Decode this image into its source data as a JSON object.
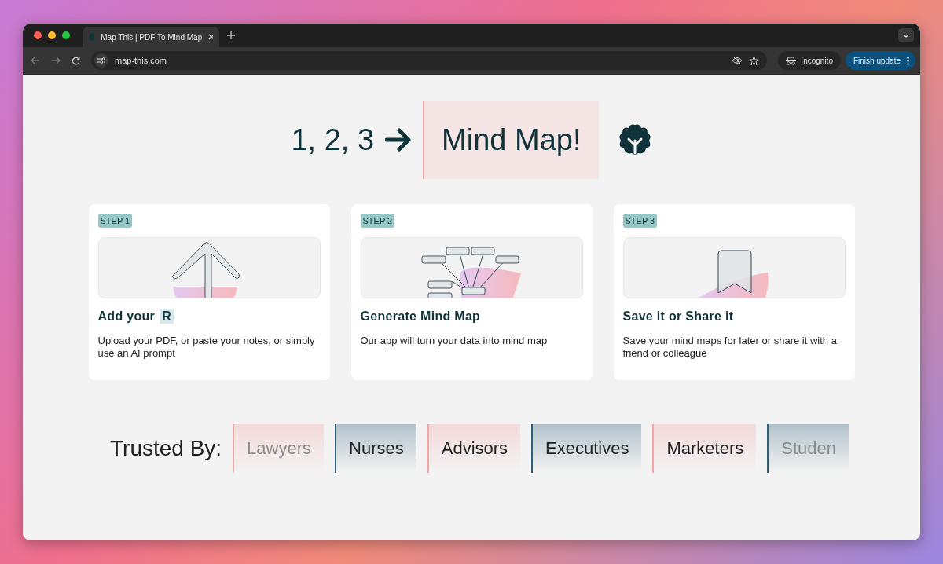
{
  "browser": {
    "tab_title": "Map This | PDF To Mind Map",
    "address": "map-this.com",
    "profile": "Incognito",
    "update_button": "Finish update"
  },
  "hero": {
    "lead": "1, 2, 3",
    "title": "Mind Map!"
  },
  "steps": [
    {
      "badge": "STEP 1",
      "kind": "upload",
      "heading": "Add your",
      "heading_highlight": "R",
      "text": "Upload your PDF, or paste your notes, or simply use an AI prompt"
    },
    {
      "badge": "STEP 2",
      "kind": "mindmap",
      "heading": "Generate Mind Map",
      "text": "Our app will turn your data into mind map"
    },
    {
      "badge": "STEP 3",
      "kind": "bookmark",
      "heading": "Save it or Share it",
      "text": "Save your mind maps for later or share it with a friend or colleague"
    }
  ],
  "trusted": {
    "label": "Trusted By:",
    "items": [
      {
        "name": "Lawyers",
        "color": "#f4a6a6",
        "faded": true
      },
      {
        "name": "Nurses",
        "color": "#2f5f7a",
        "faded": false
      },
      {
        "name": "Advisors",
        "color": "#f4a6a6",
        "faded": false
      },
      {
        "name": "Executives",
        "color": "#2f5f7a",
        "faded": false
      },
      {
        "name": "Marketers",
        "color": "#f4a6a6",
        "faded": false
      },
      {
        "name": "Studen",
        "color": "#2f5f7a",
        "faded": true
      }
    ]
  }
}
